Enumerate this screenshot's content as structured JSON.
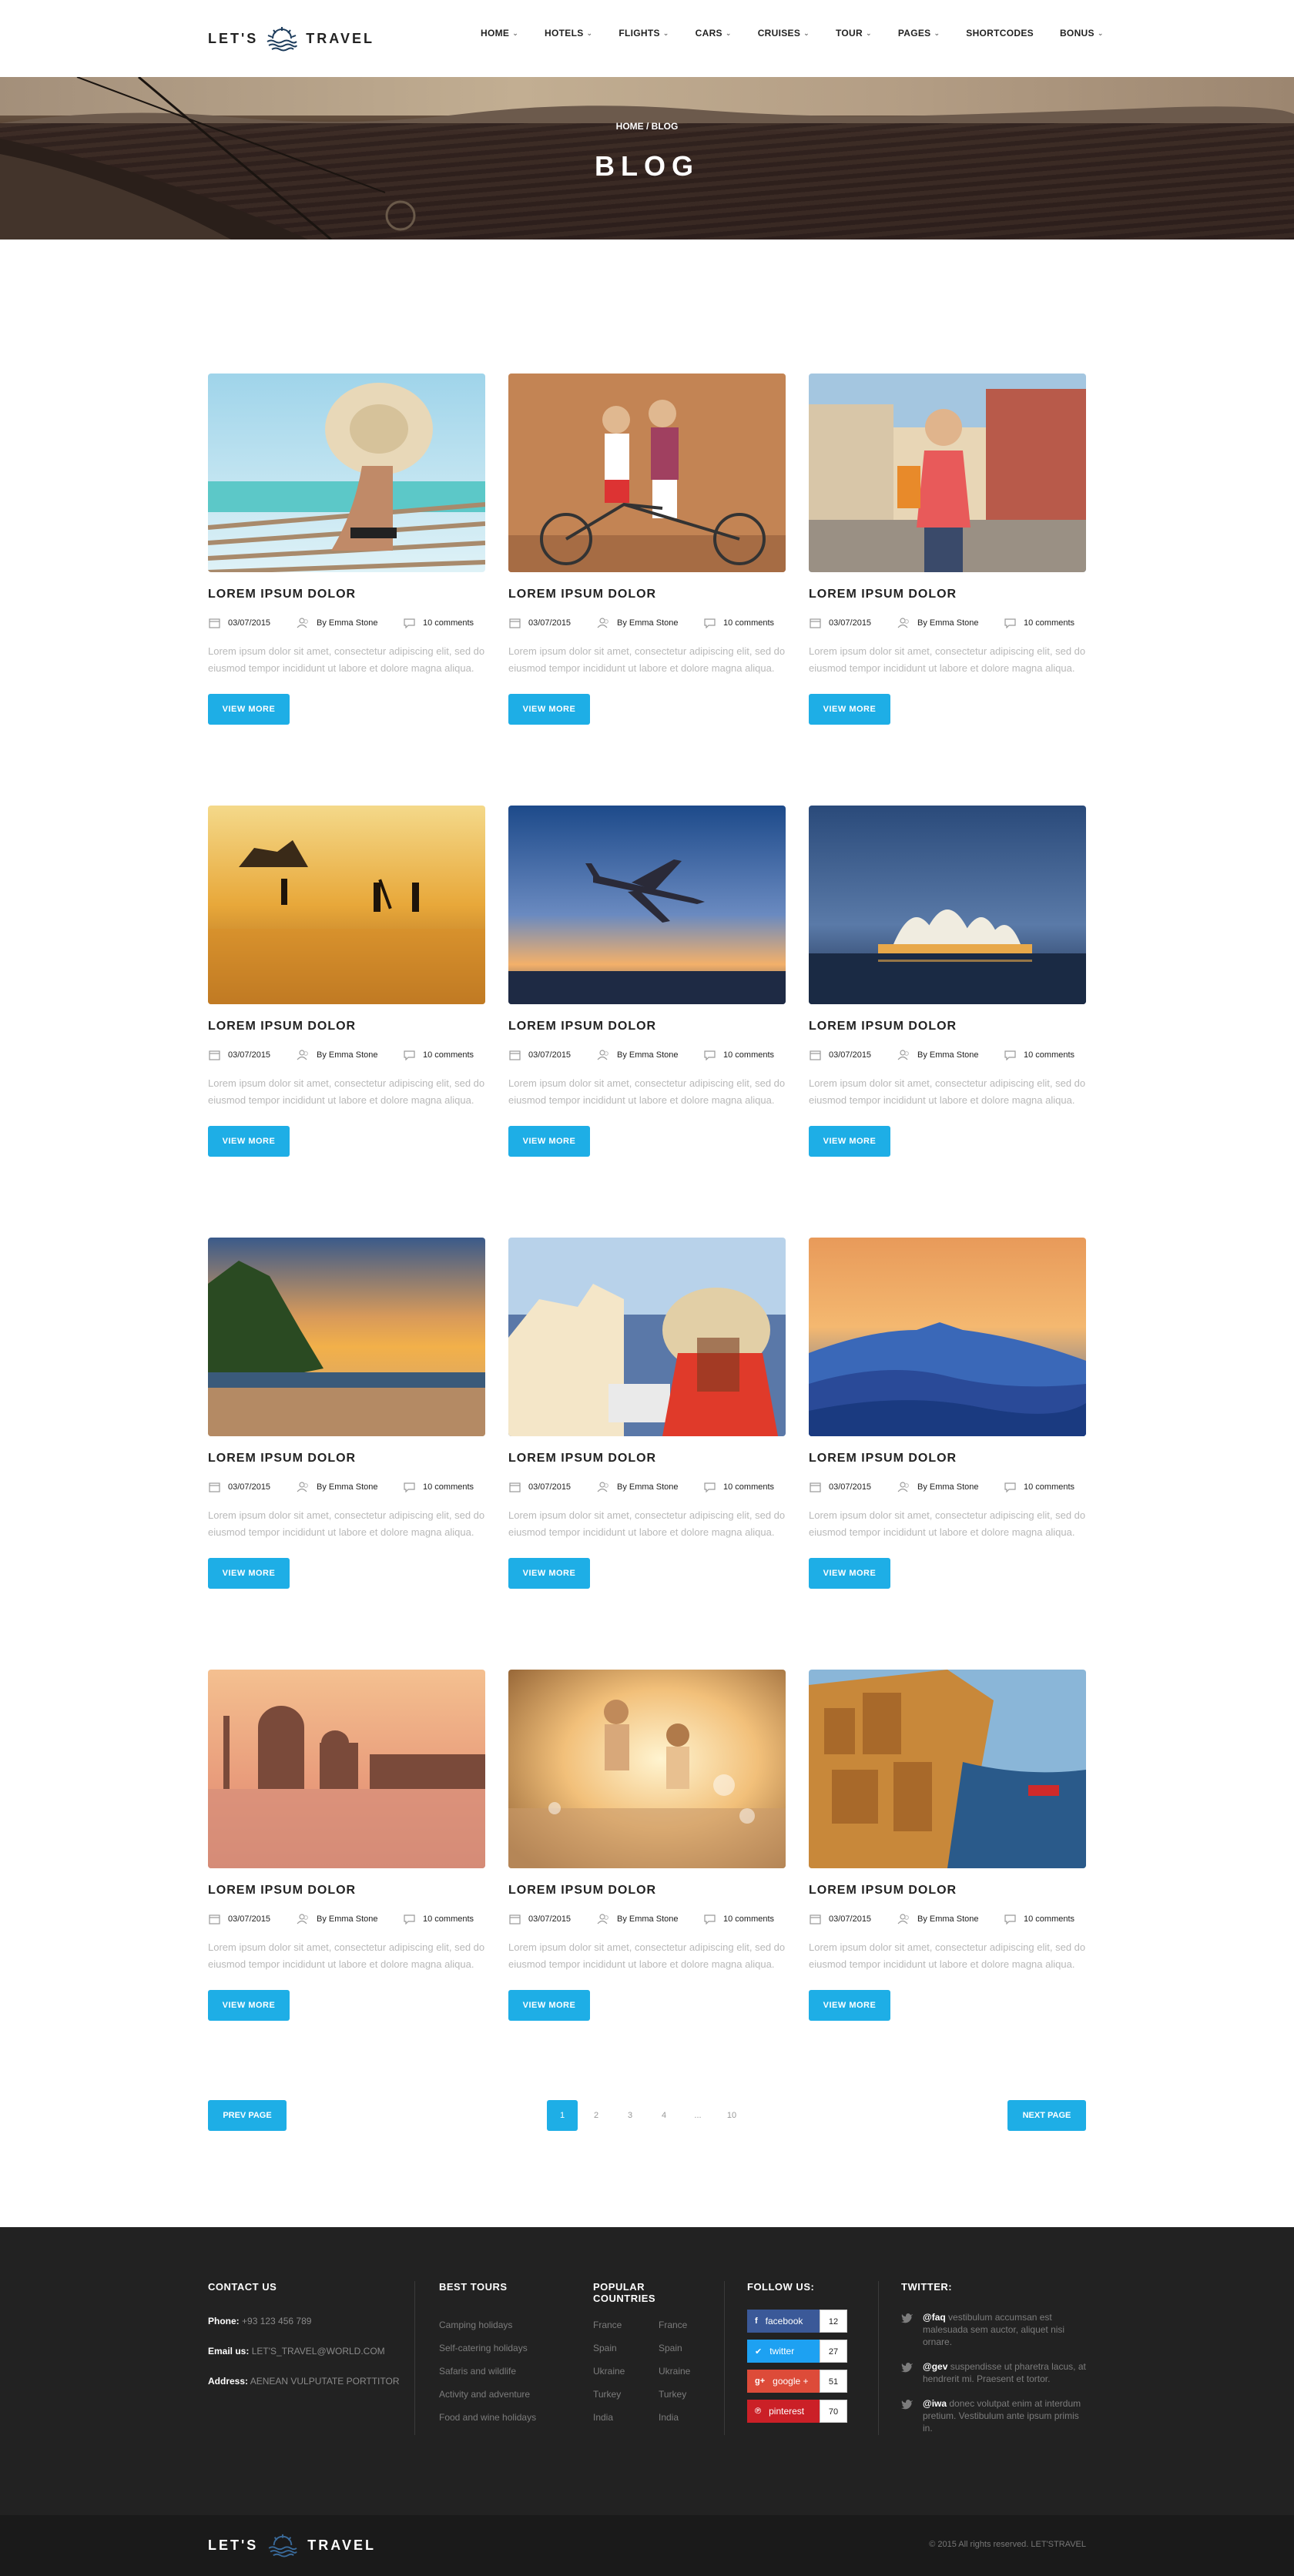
{
  "header": {
    "logo_left": "LET'S",
    "logo_right": "TRAVEL",
    "nav": [
      {
        "label": "HOME",
        "dropdown": true
      },
      {
        "label": "HOTELS",
        "dropdown": true
      },
      {
        "label": "FLIGHTS",
        "dropdown": true
      },
      {
        "label": "CARS",
        "dropdown": true
      },
      {
        "label": "CRUISES",
        "dropdown": true
      },
      {
        "label": "TOUR",
        "dropdown": true
      },
      {
        "label": "PAGES",
        "dropdown": true
      },
      {
        "label": "SHORTCODES",
        "dropdown": false
      },
      {
        "label": "BONUS",
        "dropdown": true
      }
    ]
  },
  "hero": {
    "breadcrumb": "HOME / BLOG",
    "title": "BLOG"
  },
  "posts": [
    {
      "title": "LOREM IPSUM DOLOR",
      "date": "03/07/2015",
      "author": "By Emma Stone",
      "comments": "10 comments",
      "excerpt": "Lorem ipsum dolor sit amet, consectetur adipiscing elit, sed do eiusmod tempor incididunt ut labore et dolore magna aliqua.",
      "button": "VIEW MORE",
      "image": "woman-hat-beach-dock"
    },
    {
      "title": "LOREM IPSUM DOLOR",
      "date": "03/07/2015",
      "author": "By Emma Stone",
      "comments": "10 comments",
      "excerpt": "Lorem ipsum dolor sit amet, consectetur adipiscing elit, sed do eiusmod tempor incididunt ut labore et dolore magna aliqua.",
      "button": "VIEW MORE",
      "image": "couple-with-bicycle"
    },
    {
      "title": "LOREM IPSUM DOLOR",
      "date": "03/07/2015",
      "author": "By Emma Stone",
      "comments": "10 comments",
      "excerpt": "Lorem ipsum dolor sit amet, consectetur adipiscing elit, sed do eiusmod tempor incididunt ut labore et dolore magna aliqua.",
      "button": "VIEW MORE",
      "image": "tourist-woman-old-town"
    },
    {
      "title": "LOREM IPSUM DOLOR",
      "date": "03/07/2015",
      "author": "By Emma Stone",
      "comments": "10 comments",
      "excerpt": "Lorem ipsum dolor sit amet, consectetur adipiscing elit, sed do eiusmod tempor incididunt ut labore et dolore magna aliqua.",
      "button": "VIEW MORE",
      "image": "surfers-golden-beach"
    },
    {
      "title": "LOREM IPSUM DOLOR",
      "date": "03/07/2015",
      "author": "By Emma Stone",
      "comments": "10 comments",
      "excerpt": "Lorem ipsum dolor sit amet, consectetur adipiscing elit, sed do eiusmod tempor incididunt ut labore et dolore magna aliqua.",
      "button": "VIEW MORE",
      "image": "airplane-sunset"
    },
    {
      "title": "LOREM IPSUM DOLOR",
      "date": "03/07/2015",
      "author": "By Emma Stone",
      "comments": "10 comments",
      "excerpt": "Lorem ipsum dolor sit amet, consectetur adipiscing elit, sed do eiusmod tempor incididunt ut labore et dolore magna aliqua.",
      "button": "VIEW MORE",
      "image": "sydney-opera-house"
    },
    {
      "title": "LOREM IPSUM DOLOR",
      "date": "03/07/2015",
      "author": "By Emma Stone",
      "comments": "10 comments",
      "excerpt": "Lorem ipsum dolor sit amet, consectetur adipiscing elit, sed do eiusmod tempor incididunt ut labore et dolore magna aliqua.",
      "button": "VIEW MORE",
      "image": "tropical-beach-sunset"
    },
    {
      "title": "LOREM IPSUM DOLOR",
      "date": "03/07/2015",
      "author": "By Emma Stone",
      "comments": "10 comments",
      "excerpt": "Lorem ipsum dolor sit amet, consectetur adipiscing elit, sed do eiusmod tempor incididunt ut labore et dolore magna aliqua.",
      "button": "VIEW MORE",
      "image": "woman-hat-santorini"
    },
    {
      "title": "LOREM IPSUM DOLOR",
      "date": "03/07/2015",
      "author": "By Emma Stone",
      "comments": "10 comments",
      "excerpt": "Lorem ipsum dolor sit amet, consectetur adipiscing elit, sed do eiusmod tempor incididunt ut labore et dolore magna aliqua.",
      "button": "VIEW MORE",
      "image": "blue-mountains-dusk"
    },
    {
      "title": "LOREM IPSUM DOLOR",
      "date": "03/07/2015",
      "author": "By Emma Stone",
      "comments": "10 comments",
      "excerpt": "Lorem ipsum dolor sit amet, consectetur adipiscing elit, sed do eiusmod tempor incididunt ut labore et dolore magna aliqua.",
      "button": "VIEW MORE",
      "image": "venice-sunset"
    },
    {
      "title": "LOREM IPSUM DOLOR",
      "date": "03/07/2015",
      "author": "By Emma Stone",
      "comments": "10 comments",
      "excerpt": "Lorem ipsum dolor sit amet, consectetur adipiscing elit, sed do eiusmod tempor incididunt ut labore et dolore magna aliqua.",
      "button": "VIEW MORE",
      "image": "couple-running-water"
    },
    {
      "title": "LOREM IPSUM DOLOR",
      "date": "03/07/2015",
      "author": "By Emma Stone",
      "comments": "10 comments",
      "excerpt": "Lorem ipsum dolor sit amet, consectetur adipiscing elit, sed do eiusmod tempor incididunt ut labore et dolore magna aliqua.",
      "button": "VIEW MORE",
      "image": "coastal-city-harbor"
    }
  ],
  "pagination": {
    "prev": "PREV PAGE",
    "next": "NEXT PAGE",
    "pages": [
      "1",
      "2",
      "3",
      "4",
      "...",
      "10"
    ],
    "active": "1"
  },
  "footer": {
    "contact": {
      "heading": "CONTACT US",
      "phone_label": "Phone:",
      "phone": "+93 123 456 789",
      "email_label": "Email us:",
      "email": "LET'S_TRAVEL@WORLD.COM",
      "address_label": "Address:",
      "address": "AENEAN VULPUTATE PORTTITOR"
    },
    "best_tours": {
      "heading": "BEST TOURS",
      "items": [
        "Camping holidays",
        "Self-catering holidays",
        "Safaris and wildlife",
        "Activity and adventure",
        "Food and wine holidays"
      ]
    },
    "countries": {
      "heading_1": "POPULAR",
      "heading_2": "COUNTRIES",
      "col1": [
        "France",
        "Spain",
        "Ukraine",
        "Turkey",
        "India"
      ],
      "col2": [
        "France",
        "Spain",
        "Ukraine",
        "Turkey",
        "India"
      ]
    },
    "follow": {
      "heading": "FOLLOW US:",
      "items": [
        {
          "label": "facebook",
          "count": "12",
          "color": "#3b5998",
          "icon": "facebook-icon"
        },
        {
          "label": "twitter",
          "count": "27",
          "color": "#1da1f2",
          "icon": "twitter-icon"
        },
        {
          "label": "google +",
          "count": "51",
          "color": "#dd4b39",
          "icon": "google-plus-icon"
        },
        {
          "label": "pinterest",
          "count": "70",
          "color": "#cb2027",
          "icon": "pinterest-icon"
        }
      ]
    },
    "twitter": {
      "heading": "TWITTER:",
      "tweets": [
        {
          "handle": "@faq",
          "text": " vestibulum accumsan est malesuada sem auctor, aliquet nisi ornare."
        },
        {
          "handle": "@gev",
          "text": " suspendisse ut pharetra lacus, at hendrerit mi. Praesent et tortor."
        },
        {
          "handle": "@iwa",
          "text": " donec volutpat enim at interdum pretium. Vestibulum ante ipsum primis in."
        }
      ]
    },
    "bottom_logo_left": "LET'S",
    "bottom_logo_right": "TRAVEL",
    "copyright": "© 2015 All rights reserved. LET'STRAVEL"
  },
  "colors": {
    "accent": "#1eaee6",
    "footer_bg": "#222222",
    "bottom_bg": "#1a1a1a"
  }
}
